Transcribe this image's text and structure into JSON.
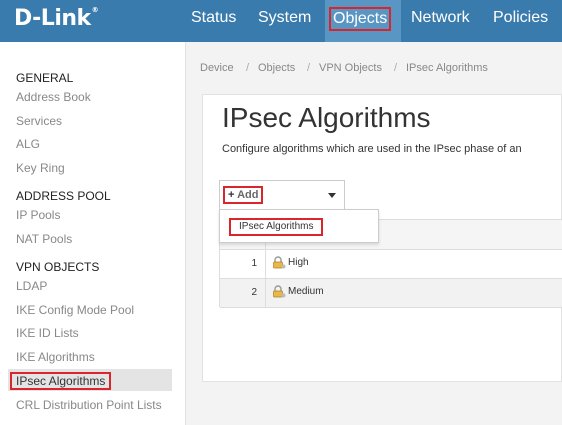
{
  "brand": {
    "logo_text": "D-Link",
    "logo_mark": "®",
    "color": "#3a7bad"
  },
  "topnav": {
    "items": [
      {
        "label": "Status"
      },
      {
        "label": "System"
      },
      {
        "label": "Objects",
        "active": true
      },
      {
        "label": "Network"
      },
      {
        "label": "Policies"
      }
    ]
  },
  "sidebar": {
    "sections": [
      {
        "heading": "GENERAL",
        "items": [
          "Address Book",
          "Services",
          "ALG",
          "Key Ring"
        ]
      },
      {
        "heading": "ADDRESS POOL",
        "items": [
          "IP Pools",
          "NAT Pools"
        ]
      },
      {
        "heading": "VPN OBJECTS",
        "items": [
          "LDAP",
          "IKE Config Mode Pool",
          "IKE ID Lists",
          "IKE Algorithms",
          "IPsec Algorithms",
          "CRL Distribution Point Lists"
        ]
      }
    ],
    "active_item": "IPsec Algorithms"
  },
  "breadcrumb": {
    "items": [
      "Device",
      "Objects",
      "VPN Objects",
      "IPsec Algorithms"
    ],
    "separator": "/"
  },
  "main": {
    "title": "IPsec Algorithms",
    "description": "Configure algorithms which are used in the IPsec phase of an",
    "add_button": {
      "plus": "+",
      "label": "Add"
    },
    "add_menu": {
      "options": [
        "IPsec Algorithms"
      ]
    },
    "table": {
      "rows": [
        {
          "index": "1",
          "name": "High",
          "icon": "lock-icon"
        },
        {
          "index": "2",
          "name": "Medium",
          "icon": "lock-icon"
        }
      ]
    }
  },
  "colors": {
    "highlight_border": "#d9262c",
    "header_bg": "#3a7bad",
    "active_nav_bg": "#5a96c4"
  }
}
